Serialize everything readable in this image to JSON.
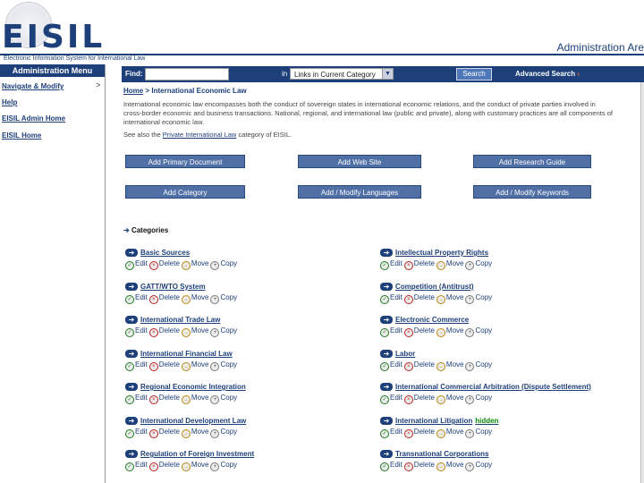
{
  "header": {
    "logo_text": "EISIL",
    "tagline": "Electronic Information System for International Law",
    "area_title": "Administration Are",
    "colors": {
      "brand": "#1d3f7a",
      "button": "#4f6fa5",
      "hidden_label": "#0a8a0a"
    }
  },
  "sidebar": {
    "menu_title": "Administration Menu",
    "items": [
      {
        "label": "Navigate & Modify",
        "arrow": ">"
      },
      {
        "label": "Help"
      },
      {
        "label": "EISIL Admin Home"
      },
      {
        "label": "EISIL Home"
      }
    ]
  },
  "search": {
    "find_label": "Find:",
    "input_value": "",
    "in_label": "in",
    "scope_selected": "Links in Current Category",
    "select_arrow_icon": "chevron-down-icon",
    "button_label": "Search",
    "advanced_label": "Advanced Search",
    "advanced_arrow": "›"
  },
  "breadcrumb": {
    "home": "Home",
    "separator": ">",
    "current": "International Economic Law"
  },
  "description": "International economic law encompasses both the conduct of sovereign states in international economic relations, and the conduct of private parties involved in cross-border economic and business transactions. National, regional, and international law (public and private), along with customary practices are all components of international economic law.",
  "see_also": {
    "prefix": "See also the",
    "link": "Private International Law",
    "suffix": "category of EISIL."
  },
  "actions": [
    "Add Primary Document",
    "Add Web Site",
    "Add Research Guide",
    "Add Category",
    "Add / Modify Languages",
    "Add / Modify Keywords"
  ],
  "categories_heading": {
    "arrow": "➔",
    "label": "Categories"
  },
  "category_actions": {
    "edit": "Edit",
    "delete": "Delete",
    "move": "Move",
    "copy": "Copy"
  },
  "category_icon": "arrow-right-icon",
  "categories_left": [
    {
      "name": "Basic Sources"
    },
    {
      "name": "GATT/WTO System"
    },
    {
      "name": "International Trade Law"
    },
    {
      "name": "International Financial Law"
    },
    {
      "name": "Regional Economic Integration"
    },
    {
      "name": "International Development Law"
    },
    {
      "name": "Regulation of Foreign Investment"
    }
  ],
  "categories_right": [
    {
      "name": "Intellectual Property Rights"
    },
    {
      "name": "Competition (Antitrust)"
    },
    {
      "name": "Electronic Commerce"
    },
    {
      "name": "Labor"
    },
    {
      "name": "International Commercial Arbitration (Dispute Settlement)"
    },
    {
      "name": "International Litigation",
      "hidden_label": "hidden"
    },
    {
      "name": "Transnational Corporations"
    }
  ]
}
